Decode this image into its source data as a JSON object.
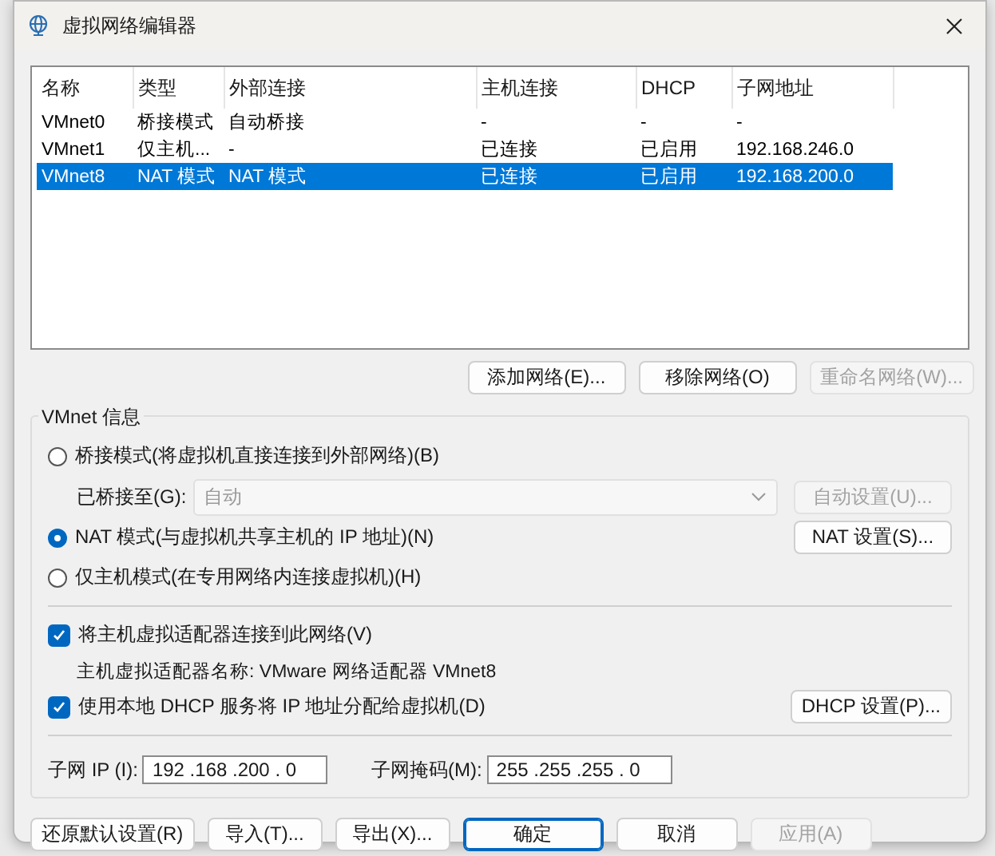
{
  "window": {
    "title": "虚拟网络编辑器"
  },
  "table": {
    "columns": [
      "名称",
      "类型",
      "外部连接",
      "主机连接",
      "DHCP",
      "子网地址"
    ],
    "rows": [
      {
        "cells": [
          "VMnet0",
          "桥接模式",
          "自动桥接",
          "-",
          "-",
          "-"
        ],
        "selected": false
      },
      {
        "cells": [
          "VMnet1",
          "仅主机...",
          "-",
          "已连接",
          "已启用",
          "192.168.246.0"
        ],
        "selected": false
      },
      {
        "cells": [
          "VMnet8",
          "NAT 模式",
          "NAT 模式",
          "已连接",
          "已启用",
          "192.168.200.0"
        ],
        "selected": true
      }
    ]
  },
  "list_buttons": [
    {
      "label": "添加网络(E)...",
      "disabled": false
    },
    {
      "label": "移除网络(O)",
      "disabled": false
    },
    {
      "label": "重命名网络(W)...",
      "disabled": true
    }
  ],
  "vmnet_info": {
    "title": "VMnet 信息",
    "modes": [
      {
        "label": "桥接模式(将虚拟机直接连接到外部网络)(B)",
        "selected": false,
        "bridged_to": {
          "label": "已桥接至(G):",
          "value": "自动",
          "disabled": true,
          "button": {
            "label": "自动设置(U)...",
            "disabled": true
          }
        }
      },
      {
        "label": "NAT 模式(与虚拟机共享主机的 IP 地址)(N)",
        "selected": true,
        "button": {
          "label": "NAT 设置(S)...",
          "disabled": false
        }
      },
      {
        "label": "仅主机模式(在专用网络内连接虚拟机)(H)",
        "selected": false
      }
    ],
    "options": [
      {
        "label": "将主机虚拟适配器连接到此网络(V)",
        "checked": true,
        "detail": {
          "label": "主机虚拟适配器名称:",
          "value": "VMware 网络适配器 VMnet8"
        }
      },
      {
        "label": "使用本地 DHCP 服务将 IP 地址分配给虚拟机(D)",
        "checked": true,
        "button": {
          "label": "DHCP 设置(P)...",
          "disabled": false
        }
      }
    ],
    "fields": [
      {
        "label": "子网 IP (I):",
        "value": "192 .168 .200 . 0"
      },
      {
        "label": "子网掩码(M):",
        "value": "255 .255 .255 . 0"
      }
    ]
  },
  "footer_buttons": [
    {
      "label": "还原默认设置(R)",
      "kind": "normal"
    },
    {
      "label": "导入(T)...",
      "kind": "normal"
    },
    {
      "label": "导出(X)...",
      "kind": "normal"
    },
    {
      "label": "确定",
      "kind": "default"
    },
    {
      "label": "取消",
      "kind": "normal"
    },
    {
      "label": "应用(A)",
      "kind": "disabled"
    }
  ]
}
